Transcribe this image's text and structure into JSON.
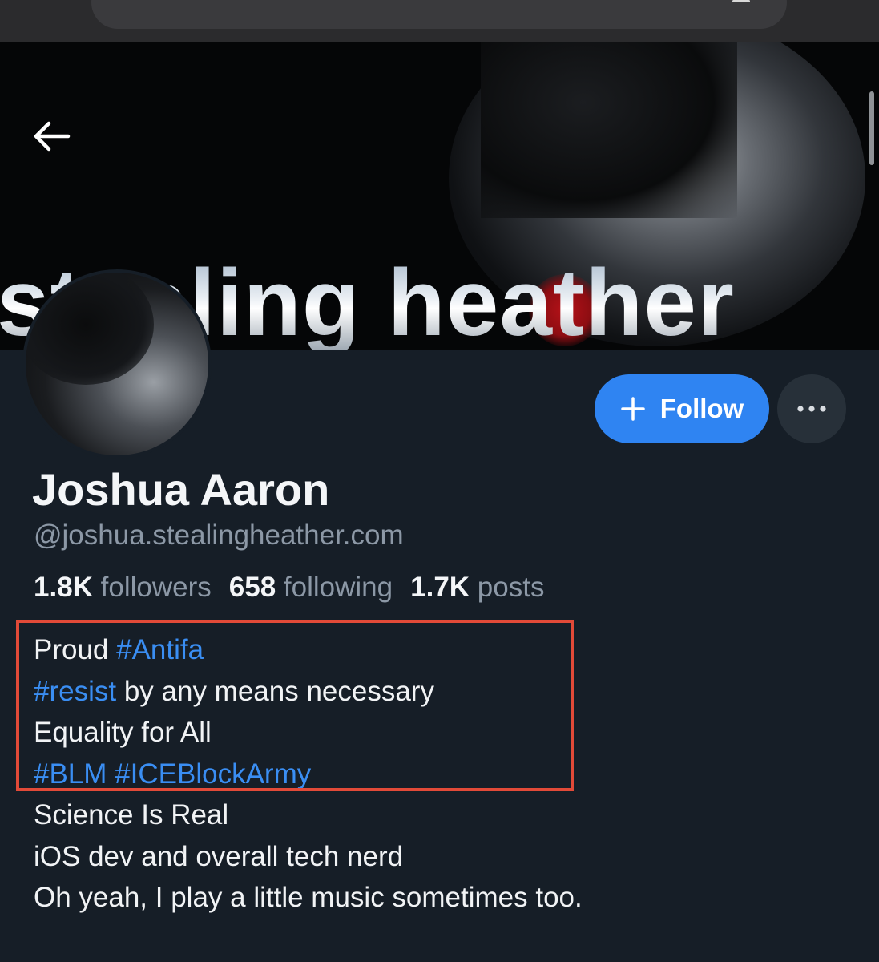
{
  "banner": {
    "text": "stealing heather"
  },
  "profile": {
    "display_name": "Joshua Aaron",
    "handle": "@joshua.stealingheather.com",
    "follow_label": "Follow",
    "stats": [
      {
        "value": "1.8K",
        "label": "followers"
      },
      {
        "value": "658",
        "label": "following"
      },
      {
        "value": "1.7K",
        "label": "posts"
      }
    ],
    "bio": [
      {
        "segments": [
          {
            "text": "Proud ",
            "tag": false
          },
          {
            "text": "#Antifa",
            "tag": true
          }
        ]
      },
      {
        "segments": [
          {
            "text": "#resist",
            "tag": true
          },
          {
            "text": " by any means necessary",
            "tag": false
          }
        ]
      },
      {
        "segments": [
          {
            "text": "Equality for All",
            "tag": false
          }
        ]
      },
      {
        "segments": [
          {
            "text": "#BLM",
            "tag": true
          },
          {
            "text": " ",
            "tag": false
          },
          {
            "text": "#ICEBlockArmy",
            "tag": true
          }
        ]
      },
      {
        "segments": [
          {
            "text": "Science Is Real",
            "tag": false
          }
        ]
      },
      {
        "segments": [
          {
            "text": "iOS dev and overall tech nerd",
            "tag": false
          }
        ]
      },
      {
        "segments": [
          {
            "text": "Oh yeah, I play a little music sometimes too.",
            "tag": false
          }
        ]
      }
    ]
  },
  "colors": {
    "background": "#161e27",
    "accent": "#2f84f2",
    "hashtag": "#3a8ef3",
    "muted_text": "#8c98a6",
    "highlight_box": "#e24a38"
  },
  "icons": {
    "back": "arrow-left-icon",
    "follow": "plus-icon",
    "more": "ellipsis-icon"
  }
}
